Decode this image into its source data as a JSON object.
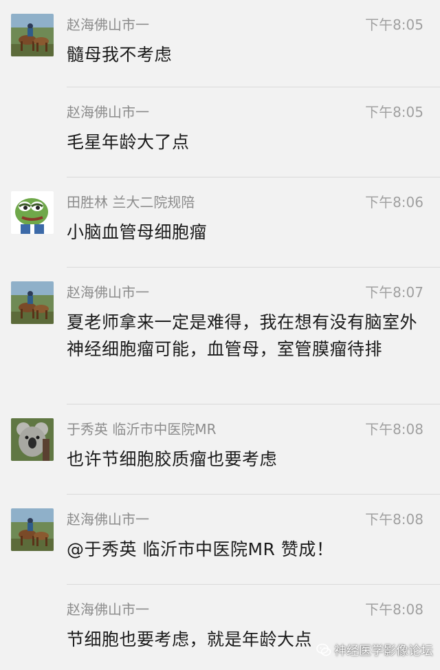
{
  "messages": [
    {
      "sender": "赵海佛山市一",
      "time": "下午8:05",
      "text": "髓母我不考虑",
      "avatar": "horse-rider-avatar"
    },
    {
      "sender": "赵海佛山市一",
      "time": "下午8:05",
      "text": "毛星年龄大了点",
      "avatar": null
    },
    {
      "sender": "田胜林 兰大二院规陪",
      "time": "下午8:06",
      "text": "小脑血管母细胞瘤",
      "avatar": "frog-avatar"
    },
    {
      "sender": "赵海佛山市一",
      "time": "下午8:07",
      "text": "夏老师拿来一定是难得，我在想有没有脑室外神经细胞瘤可能，血管母，室管膜瘤待排",
      "avatar": "horse-rider-avatar"
    },
    {
      "sender": "于秀英 临沂市中医院MR",
      "time": "下午8:08",
      "text": "也许节细胞胶质瘤也要考虑",
      "avatar": "koala-avatar"
    },
    {
      "sender": "赵海佛山市一",
      "time": "下午8:08",
      "text": "@于秀英 临沂市中医院MR 赞成！",
      "avatar": "horse-rider-avatar"
    },
    {
      "sender": "赵海佛山市一",
      "time": "下午8:08",
      "text": "节细胞也要考虑，就是年龄大点",
      "avatar": null
    }
  ],
  "watermark": {
    "text": "神经医学影像论坛",
    "icon": "wechat-icon"
  }
}
